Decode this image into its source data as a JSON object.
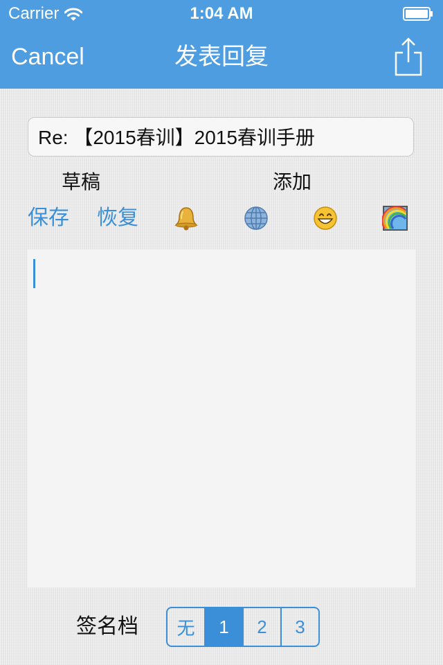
{
  "status_bar": {
    "carrier": "Carrier",
    "time": "1:04 AM"
  },
  "nav": {
    "cancel_label": "Cancel",
    "title": "发表回复"
  },
  "subject": {
    "value": "Re: 【2015春训】2015春训手册"
  },
  "labels": {
    "draft": "草稿",
    "add": "添加"
  },
  "actions": {
    "save": "保存",
    "restore": "恢复"
  },
  "insert_icons": [
    "bell-icon",
    "globe-icon",
    "smiley-icon",
    "rainbow-image-icon"
  ],
  "editor": {
    "value": ""
  },
  "signature": {
    "label": "签名档",
    "options": [
      "无",
      "1",
      "2",
      "3"
    ],
    "selected": "1"
  },
  "colors": {
    "nav_background": "#4d9de0",
    "accent": "#3b8fd8",
    "page_background": "#ebebeb"
  }
}
